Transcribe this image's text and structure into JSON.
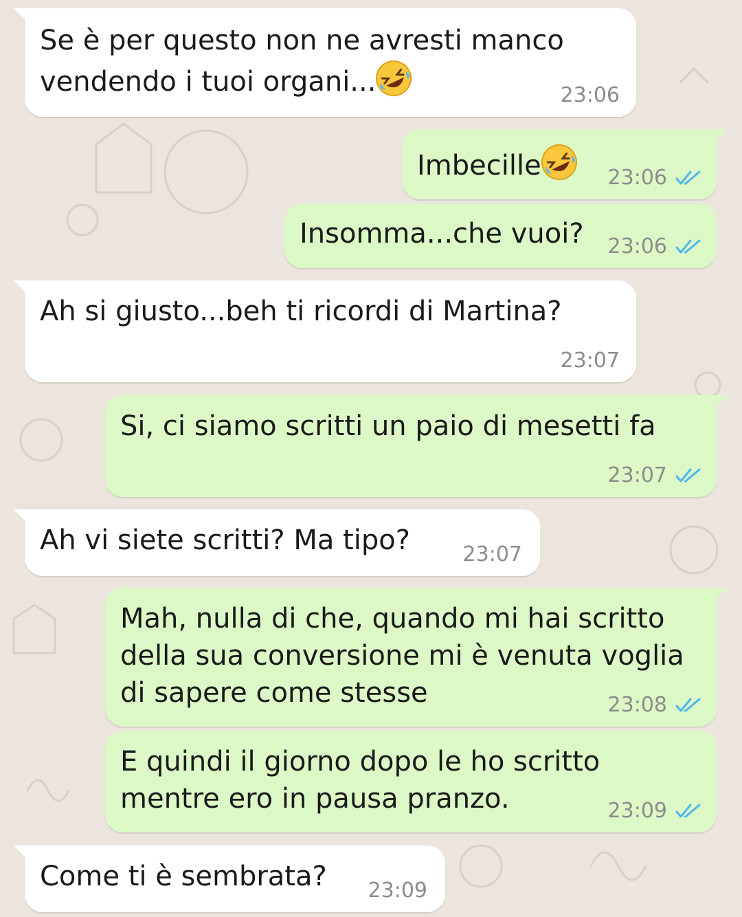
{
  "messages": [
    {
      "direction": "incoming",
      "lines": [
        "Se è per questo non ne avresti manco",
        "vendendo i tuoi organi..."
      ],
      "emoji": "rolling-on-floor-laughing-emoji",
      "time": "23:06"
    },
    {
      "direction": "outgoing",
      "lines": [
        "Imbecille"
      ],
      "emoji": "rolling-on-floor-laughing-emoji",
      "time": "23:06",
      "status": "read-double-check"
    },
    {
      "direction": "outgoing",
      "lines": [
        "Insomma...che vuoi?"
      ],
      "time": "23:06",
      "status": "read-double-check"
    },
    {
      "direction": "incoming",
      "lines": [
        "Ah si giusto...beh ti ricordi di Martina?"
      ],
      "time": "23:07"
    },
    {
      "direction": "outgoing",
      "lines": [
        "Si, ci siamo scritti un paio di mesetti fa"
      ],
      "time": "23:07",
      "status": "read-double-check"
    },
    {
      "direction": "incoming",
      "lines": [
        "Ah vi siete scritti? Ma tipo?"
      ],
      "time": "23:07"
    },
    {
      "direction": "outgoing",
      "lines": [
        "Mah, nulla di che, quando mi hai scritto",
        "della sua conversione mi è venuta voglia",
        "di sapere come stesse"
      ],
      "time": "23:08",
      "status": "read-double-check"
    },
    {
      "direction": "outgoing",
      "lines": [
        "E quindi il giorno dopo le ho scritto",
        "mentre ero in pausa pranzo."
      ],
      "time": "23:09",
      "status": "read-double-check"
    },
    {
      "direction": "incoming",
      "lines": [
        "Come ti è sembrata?"
      ],
      "time": "23:09"
    }
  ],
  "colors": {
    "wallpaper": "#ece5dd",
    "incoming_bubble": "#ffffff",
    "outgoing_bubble": "#dcf8c6",
    "read_ticks": "#4fb6ec",
    "timestamp": "#8c8c8c"
  },
  "icons": {
    "read_receipt": "double-check-icon",
    "emoji": "rolling-on-floor-laughing-emoji"
  }
}
